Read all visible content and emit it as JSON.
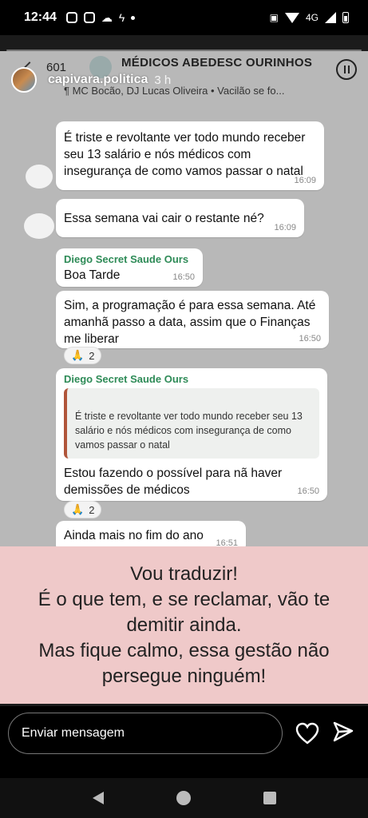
{
  "status": {
    "time": "12:44",
    "network": "4G"
  },
  "story": {
    "username": "capivara.politica",
    "age": "3 h"
  },
  "chat": {
    "count": "601",
    "title": "MÉDICOS ABEDESC OURINHOS",
    "subtitle": "¶ MC Bocão, DJ Lucas Oliveira • Vacilão se fo...",
    "messages": [
      {
        "text": "É triste e revoltante ver todo mundo receber seu 13 salário e nós médicos com insegurança de como vamos passar o natal",
        "time": "16:09"
      },
      {
        "text": "Essa semana vai cair o restante né?",
        "time": "16:09"
      },
      {
        "sender": "Diego Secret Saude Ours",
        "text": "Boa Tarde",
        "time": "16:50"
      },
      {
        "text": "Sim, a programação é para essa semana. Até amanhã passo a data, assim que o Finanças me liberar",
        "time": "16:50",
        "reaction": "🙏",
        "reaction_count": "2"
      },
      {
        "sender": "Diego Secret Saude Ours",
        "quote": "É triste e revoltante ver todo mundo receber seu 13 salário e nós médicos com insegurança de como vamos passar o natal",
        "text": "Estou fazendo o possível para nã haver demissões de médicos",
        "time": "16:50",
        "reaction": "🙏",
        "reaction_count": "2"
      },
      {
        "text": "Ainda mais no fim do ano",
        "time": "16:51"
      }
    ]
  },
  "caption": "Vou traduzir!\nÉ o que tem, e se reclamar, vão te demitir ainda.\nMas fique calmo, essa gestão não persegue ninguém!",
  "reply": {
    "placeholder": "Enviar mensagem"
  }
}
